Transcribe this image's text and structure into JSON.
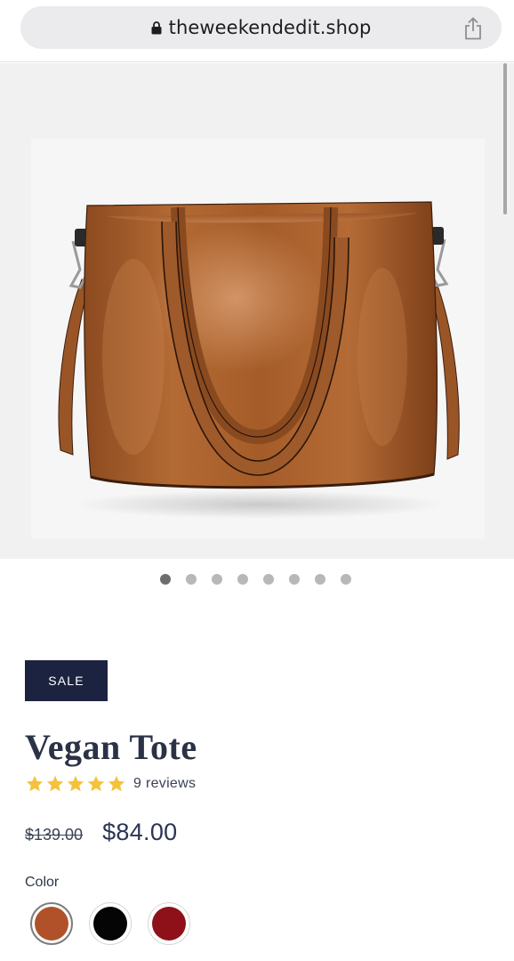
{
  "browser": {
    "url": "theweekendedit.shop",
    "icons": [
      "lock-icon",
      "share-icon"
    ]
  },
  "gallery": {
    "image": "brown-leather-tote-bag",
    "slide_count": 8,
    "active_slide": 1
  },
  "product": {
    "badge": "SALE",
    "title": "Vegan Tote",
    "rating": 5,
    "reviews": "9 reviews",
    "price_original": "$139.00",
    "price_sale": "$84.00"
  },
  "options": {
    "color_label": "Color",
    "colors": [
      {
        "name": "brown",
        "hex": "#b0512a",
        "selected": true
      },
      {
        "name": "black",
        "hex": "#050505",
        "selected": false
      },
      {
        "name": "red",
        "hex": "#8e1119",
        "selected": false
      }
    ]
  },
  "theme": {
    "badge_bg": "#1c2340",
    "star_color": "#f4c23c",
    "title_color": "#2b3246"
  }
}
